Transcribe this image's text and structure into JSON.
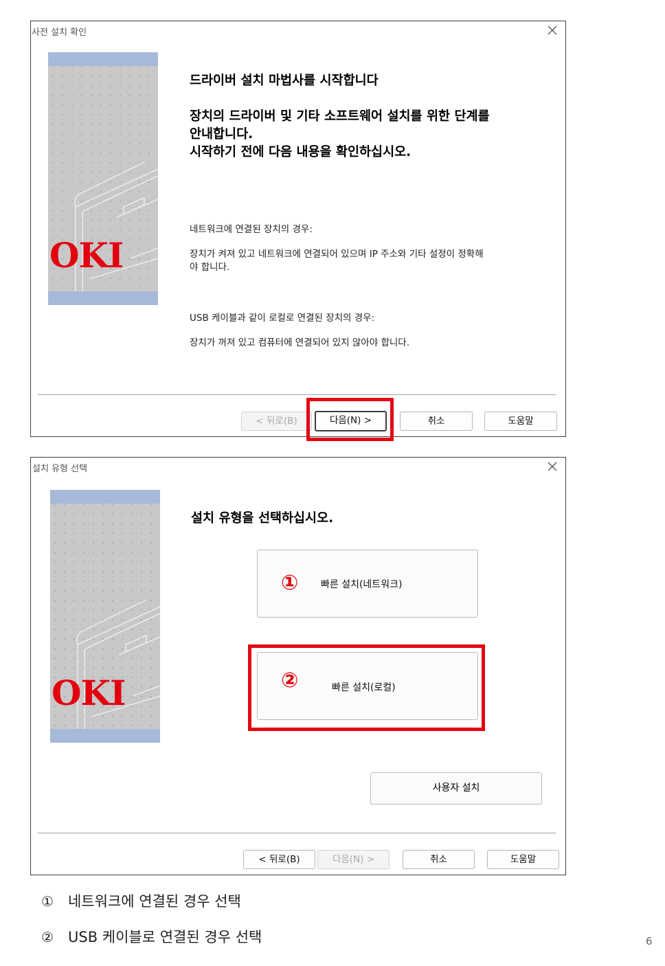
{
  "dialog1": {
    "title": "사전 설치 확인",
    "logo": "OKI",
    "heading": "드라이버 설치 마법사를 시작합니다",
    "intro_line1": "장치의 드라이버 및 기타 소프트웨어 설치를 위한 단계를",
    "intro_line2": "안내합니다.",
    "intro_line3": "시작하기 전에 다음 내용을 확인하십시오.",
    "network_title": "네트워크에 연결된 장치의 경우:",
    "network_line1": "장치가 켜져 있고 네트워크에 연결되어 있으며 IP 주소와 기타 설정이 정확해",
    "network_line2": "야 합니다.",
    "usb_title": "USB 케이블과 같이 로컬로 연결된 장치의 경우:",
    "usb_desc": "장치가 꺼져 있고 컴퓨터에 연결되어 있지 않아야 합니다.",
    "buttons": {
      "back": "< 뒤로(B)",
      "next": "다음(N) >",
      "cancel": "취소",
      "help": "도움말"
    }
  },
  "dialog2": {
    "title": "설치 유형 선택",
    "logo": "OKI",
    "heading": "설치 유형을 선택하십시오.",
    "option1": {
      "marker": "①",
      "label": "빠른 설치(네트워크)"
    },
    "option2": {
      "marker": "②",
      "label": "빠른 설치(로컬)"
    },
    "custom_label": "사용자 설치",
    "buttons": {
      "back": "< 뒤로(B)",
      "next": "다음(N) >",
      "cancel": "취소",
      "help": "도움말"
    }
  },
  "captions": [
    {
      "marker": "①",
      "text": "네트워크에 연결된 경우 선택"
    },
    {
      "marker": "②",
      "text": "USB 케이블로 연결된 경우 선택"
    }
  ],
  "page_number": "6",
  "colors": {
    "highlight": "#e30613",
    "oki_red": "#e3000f",
    "panel_gray": "#c8c8c8",
    "panel_band": "#a7b9d9"
  }
}
